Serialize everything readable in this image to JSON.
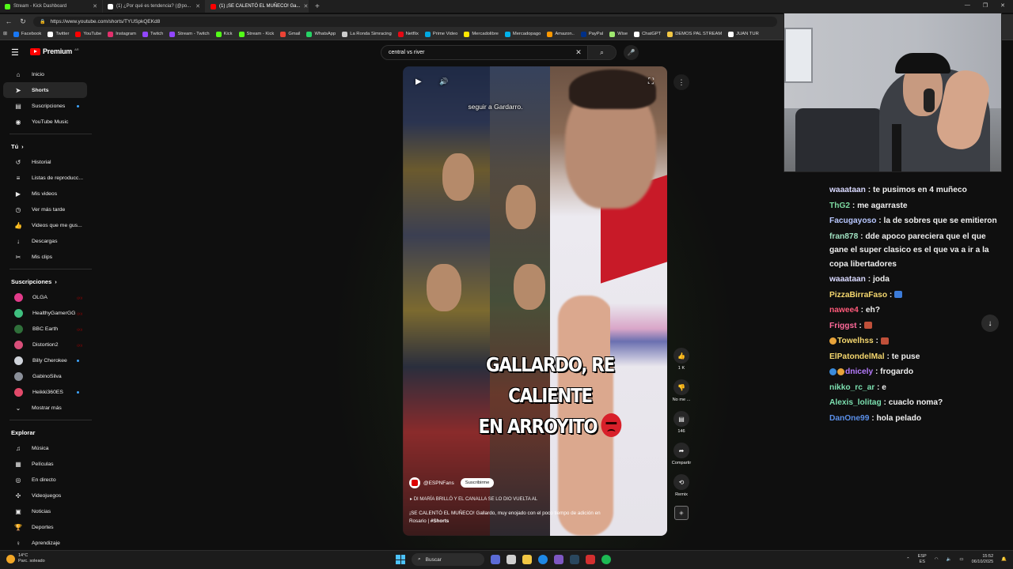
{
  "browser": {
    "tabs": [
      {
        "title": "Stream - Kick Dashboard",
        "color": "#53fc18",
        "active": false
      },
      {
        "title": "(1) ¿Por qué es tendencia? (@po...",
        "color": "#ffffff",
        "active": false
      },
      {
        "title": "(1) ¡SE CALENTÓ EL MUÑECO! Ga...",
        "color": "#ff0000",
        "active": true
      }
    ],
    "new_tab": "+",
    "url": "https://www.youtube.com/shorts/TYUSpkQEKd8",
    "bookmarks": [
      {
        "label": "Facebook",
        "color": "#1877f2"
      },
      {
        "label": "Twitter",
        "color": "#ffffff"
      },
      {
        "label": "YouTube",
        "color": "#ff0000"
      },
      {
        "label": "Instagram",
        "color": "#e1306c"
      },
      {
        "label": "Twitch",
        "color": "#9146ff"
      },
      {
        "label": "Stream - Twitch",
        "color": "#9146ff"
      },
      {
        "label": "Kick",
        "color": "#53fc18"
      },
      {
        "label": "Stream - Kick",
        "color": "#53fc18"
      },
      {
        "label": "Gmail",
        "color": "#ea4335"
      },
      {
        "label": "WhatsApp",
        "color": "#25d366"
      },
      {
        "label": "La Ronda Simracing",
        "color": "#cccccc"
      },
      {
        "label": "Netflix",
        "color": "#e50914"
      },
      {
        "label": "Prime Video",
        "color": "#00a8e1"
      },
      {
        "label": "Mercadolibre",
        "color": "#ffe600"
      },
      {
        "label": "Mercadopago",
        "color": "#00b1ea"
      },
      {
        "label": "Amazon..",
        "color": "#ff9900"
      },
      {
        "label": "PayPal",
        "color": "#003087"
      },
      {
        "label": "Wise",
        "color": "#9fe870"
      },
      {
        "label": "ChatGPT",
        "color": "#ffffff"
      },
      {
        "label": "DEMOS PAL STREAM",
        "color": "#f2c744"
      },
      {
        "label": "JUAN TUR",
        "color": "#ffffff"
      }
    ]
  },
  "youtube": {
    "logo": "Premium",
    "logo_suffix": "AR",
    "search_query": "central vs river",
    "sidebar": {
      "main": [
        {
          "label": "Inicio",
          "icon": "home-icon",
          "glyph": "⌂",
          "active": false
        },
        {
          "label": "Shorts",
          "icon": "shorts-icon",
          "glyph": "➤",
          "active": true
        },
        {
          "label": "Suscripciones",
          "icon": "subscriptions-icon",
          "glyph": "▤",
          "active": false,
          "dot": true
        },
        {
          "label": "YouTube Music",
          "icon": "youtube-music-icon",
          "glyph": "◉",
          "active": false
        }
      ],
      "you_heading": "Tú",
      "you": [
        {
          "label": "Historial",
          "icon": "history-icon",
          "glyph": "↺"
        },
        {
          "label": "Listas de reproducc...",
          "icon": "playlists-icon",
          "glyph": "≡"
        },
        {
          "label": "Mis videos",
          "icon": "my-videos-icon",
          "glyph": "▶"
        },
        {
          "label": "Ver más tarde",
          "icon": "watch-later-icon",
          "glyph": "◷"
        },
        {
          "label": "Videos que me gus...",
          "icon": "liked-videos-icon",
          "glyph": "👍"
        },
        {
          "label": "Descargas",
          "icon": "downloads-icon",
          "glyph": "↓"
        },
        {
          "label": "Mis clips",
          "icon": "clips-icon",
          "glyph": "✂"
        }
      ],
      "subs_heading": "Suscripciones",
      "subs": [
        {
          "label": "OLGA",
          "color": "#e23b8a",
          "live": true,
          "dot": false
        },
        {
          "label": "HealthyGamerGG",
          "color": "#3fbf7f",
          "live": true,
          "dot": false
        },
        {
          "label": "BBC Earth",
          "color": "#2f6f3a",
          "live": true,
          "dot": false
        },
        {
          "label": "Distortion2",
          "color": "#d94f7a",
          "live": true,
          "dot": false
        },
        {
          "label": "Billy Cherokee",
          "color": "#cfd3da",
          "live": false,
          "dot": true
        },
        {
          "label": "GabinoSilva",
          "color": "#8a8f99",
          "live": false,
          "dot": false
        },
        {
          "label": "Heikki360ES",
          "color": "#e24a6a",
          "live": false,
          "dot": true
        }
      ],
      "show_more": "Mostrar más",
      "explore_heading": "Explorar",
      "explore": [
        {
          "label": "Música",
          "icon": "music-icon",
          "glyph": "♫"
        },
        {
          "label": "Películas",
          "icon": "movies-icon",
          "glyph": "▦"
        },
        {
          "label": "En directo",
          "icon": "live-icon",
          "glyph": "◎"
        },
        {
          "label": "Videojuegos",
          "icon": "gaming-icon",
          "glyph": "✣"
        },
        {
          "label": "Noticias",
          "icon": "news-icon",
          "glyph": "▣"
        },
        {
          "label": "Deportes",
          "icon": "sports-icon",
          "glyph": "🏆"
        },
        {
          "label": "Aprendizaje",
          "icon": "learning-icon",
          "glyph": "♀"
        }
      ]
    },
    "short": {
      "subtitle": "seguir a Gardarro.",
      "caption_line1": "GALLARDO, RE CALIENTE",
      "caption_line2": "EN ARROYITO",
      "channel": "@ESPNFans",
      "subscribe": "Suscribirme",
      "music": "DI MARÍA BRILLÓ Y EL CANALLA SE LO DIO VUELTA AL",
      "description": "¡SE CALENTÓ EL MUÑECO! Gallardo, muy enojado con el poco tiempo de adición en Rosario | ",
      "hashtag": "#Shorts",
      "likes": "1 K",
      "dislike": "No me ...",
      "comments": "146",
      "share": "Compartir",
      "remix": "Remix"
    }
  },
  "chat": {
    "messages": [
      {
        "user": "waaataan",
        "color": "#d9d9ff",
        "text": "te pusimos en 4 muñeco"
      },
      {
        "user": "ThG2",
        "color": "#7cd9a0",
        "text": "me agarraste"
      },
      {
        "user": "Facugayoso",
        "color": "#b8c7ff",
        "text": "la de sobres que se emitieron"
      },
      {
        "user": "fran878",
        "color": "#9fe0c0",
        "text": "dde apoco pareciera que el que gane el super clasico es el que va a ir a la copa libertadores"
      },
      {
        "user": "waaataan",
        "color": "#d9d9ff",
        "text": "joda"
      },
      {
        "user": "PizzaBirraFaso",
        "color": "#f5d76e",
        "text": "",
        "emote": "#3b7bd9"
      },
      {
        "user": "nawee4",
        "color": "#ff5a7a",
        "text": "eh?"
      },
      {
        "user": "Friggst",
        "color": "#ff6a9a",
        "text": "",
        "emote": "#c0503a"
      },
      {
        "user": "Towelhss",
        "color": "#f5d76e",
        "text": "",
        "emote": "#c0503a",
        "badge": "#e8a33a"
      },
      {
        "user": "ElPatondelMal",
        "color": "#f5d76e",
        "text": "te puse"
      },
      {
        "user": "dnicely",
        "color": "#b77cff",
        "text": "frogardo",
        "badge": "#3a8ad9",
        "badge2": "#e8a33a"
      },
      {
        "user": "nikko_rc_ar",
        "color": "#7ce0b0",
        "text": "e"
      },
      {
        "user": "Alexis_lolitag",
        "color": "#7ce0b0",
        "text": "cuaclo noma?"
      },
      {
        "user": "DanOne99",
        "color": "#5a8fe8",
        "text": "hola pelado"
      }
    ]
  },
  "taskbar": {
    "temp": "14°C",
    "weather": "Parc. soleado",
    "search": "Buscar",
    "lang1": "ESP",
    "lang2": "ES",
    "time": "15:52",
    "date": "06/10/2025"
  }
}
